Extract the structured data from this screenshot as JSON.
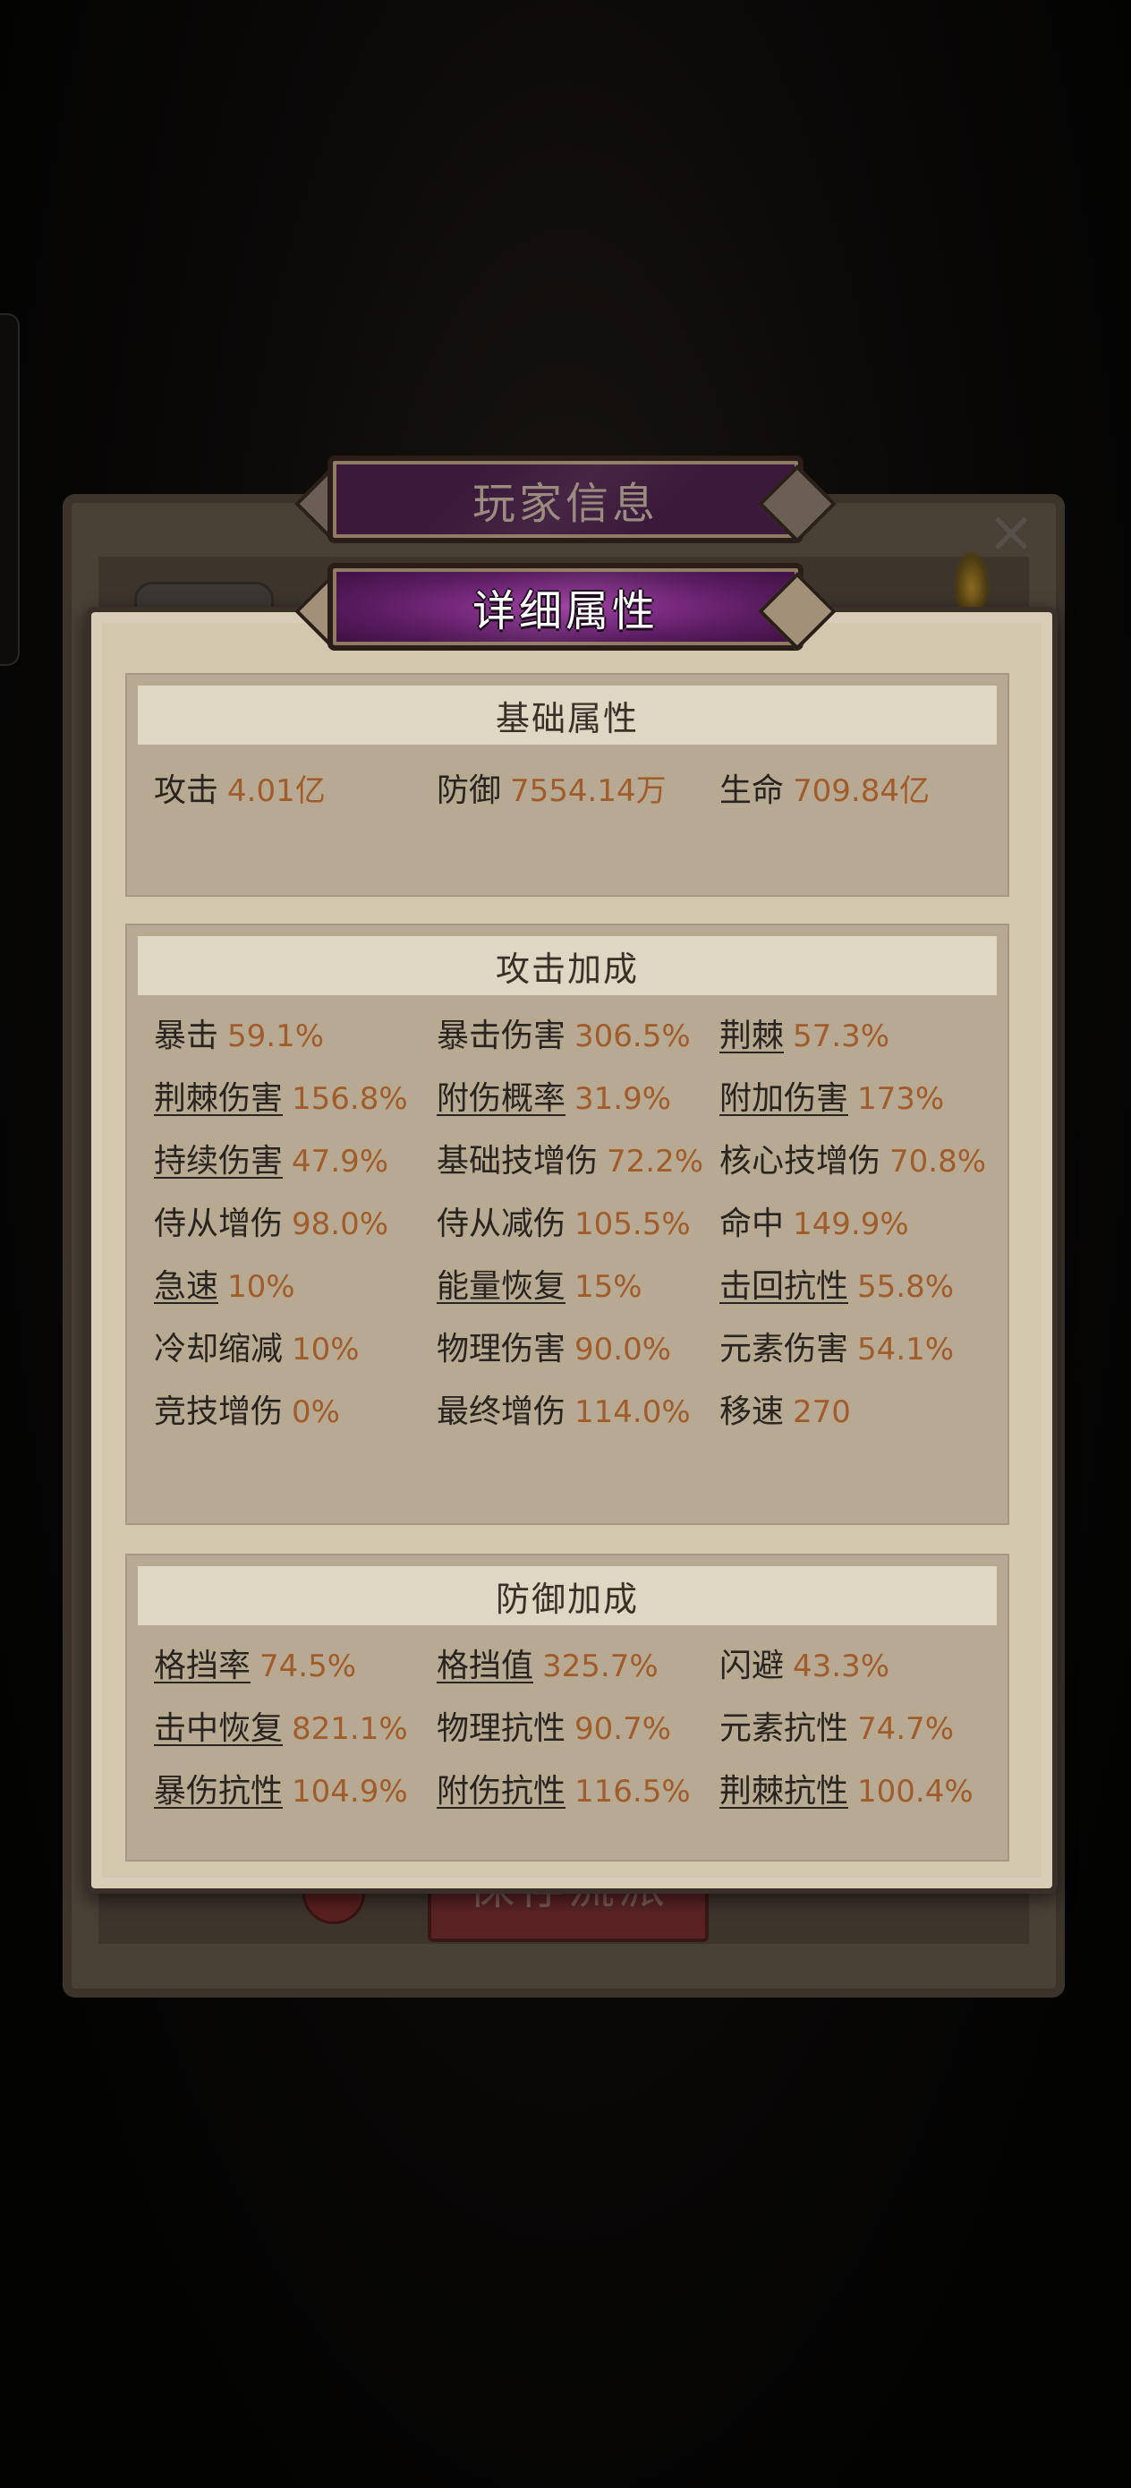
{
  "banners": {
    "back_title": "玩家信息",
    "front_title": "详细属性"
  },
  "back": {
    "button_label": "保存流派"
  },
  "close_glyph": "×",
  "sections": {
    "base": {
      "title": "基础属性",
      "rows": [
        [
          {
            "label": "攻击",
            "value": "4.01亿",
            "link": false
          },
          {
            "label": "防御",
            "value": "7554.14万",
            "link": false
          },
          {
            "label": "生命",
            "value": "709.84亿",
            "link": false
          }
        ]
      ]
    },
    "attack": {
      "title": "攻击加成",
      "rows": [
        [
          {
            "label": "暴击",
            "value": "59.1%",
            "link": false
          },
          {
            "label": "暴击伤害",
            "value": "306.5%",
            "link": false
          },
          {
            "label": "荆棘",
            "value": "57.3%",
            "link": true
          }
        ],
        [
          {
            "label": "荆棘伤害",
            "value": "156.8%",
            "link": true
          },
          {
            "label": "附伤概率",
            "value": "31.9%",
            "link": true
          },
          {
            "label": "附加伤害",
            "value": "173%",
            "link": true
          }
        ],
        [
          {
            "label": "持续伤害",
            "value": "47.9%",
            "link": true
          },
          {
            "label": "基础技增伤",
            "value": "72.2%",
            "link": false
          },
          {
            "label": "核心技增伤",
            "value": "70.8%",
            "link": false
          }
        ],
        [
          {
            "label": "侍从增伤",
            "value": "98.0%",
            "link": false
          },
          {
            "label": "侍从减伤",
            "value": "105.5%",
            "link": false
          },
          {
            "label": "命中",
            "value": "149.9%",
            "link": false
          }
        ],
        [
          {
            "label": "急速",
            "value": "10%",
            "link": true
          },
          {
            "label": "能量恢复",
            "value": "15%",
            "link": true
          },
          {
            "label": "击回抗性",
            "value": "55.8%",
            "link": true
          }
        ],
        [
          {
            "label": "冷却缩减",
            "value": "10%",
            "link": false
          },
          {
            "label": "物理伤害",
            "value": "90.0%",
            "link": false
          },
          {
            "label": "元素伤害",
            "value": "54.1%",
            "link": false
          }
        ],
        [
          {
            "label": "竞技增伤",
            "value": "0%",
            "link": false
          },
          {
            "label": "最终增伤",
            "value": "114.0%",
            "link": false
          },
          {
            "label": "移速",
            "value": "270",
            "link": false
          }
        ]
      ]
    },
    "defense": {
      "title": "防御加成",
      "rows": [
        [
          {
            "label": "格挡率",
            "value": "74.5%",
            "link": true
          },
          {
            "label": "格挡值",
            "value": "325.7%",
            "link": true
          },
          {
            "label": "闪避",
            "value": "43.3%",
            "link": false
          }
        ],
        [
          {
            "label": "击中恢复",
            "value": "821.1%",
            "link": true
          },
          {
            "label": "物理抗性",
            "value": "90.7%",
            "link": false
          },
          {
            "label": "元素抗性",
            "value": "74.7%",
            "link": false
          }
        ],
        [
          {
            "label": "暴伤抗性",
            "value": "104.9%",
            "link": true
          },
          {
            "label": "附伤抗性",
            "value": "116.5%",
            "link": true
          },
          {
            "label": "荆棘抗性",
            "value": "100.4%",
            "link": true
          }
        ]
      ]
    }
  }
}
